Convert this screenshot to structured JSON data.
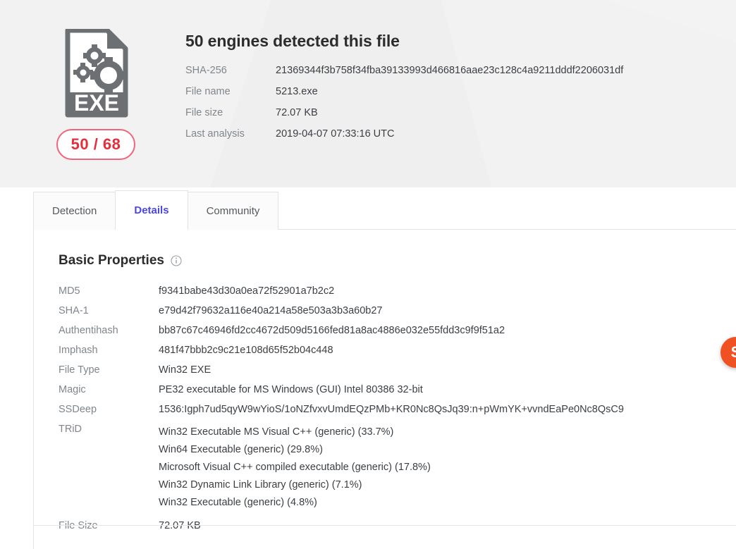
{
  "header": {
    "detection_title": "50 engines detected this file",
    "ratio_badge": "50 / 68",
    "file_icon_label": "EXE",
    "meta": [
      {
        "label": "SHA-256",
        "value": "21369344f3b758f34fba39133993d466816aae23c128c4a9211dddf2206031df"
      },
      {
        "label": "File name",
        "value": "5213.exe"
      },
      {
        "label": "File size",
        "value": "72.07 KB"
      },
      {
        "label": "Last analysis",
        "value": "2019-04-07 07:33:16 UTC"
      }
    ]
  },
  "tabs": [
    {
      "label": "Detection",
      "active": false
    },
    {
      "label": "Details",
      "active": true
    },
    {
      "label": "Community",
      "active": false
    }
  ],
  "details": {
    "section_title": "Basic Properties",
    "info_icon": "info-icon",
    "properties": [
      {
        "label": "MD5",
        "value": "f9341babe43d30a0ea72f52901a7b2c2"
      },
      {
        "label": "SHA-1",
        "value": "e79d42f79632a116e40a214a58e503a3b3a60b27"
      },
      {
        "label": "Authentihash",
        "value": "bb87c67c46946fd2cc4672d509d5166fed81a8ac4886e032e55fdd3c9f9f51a2"
      },
      {
        "label": "Imphash",
        "value": "481f47bbb2c9c21e108d65f52b04c448"
      },
      {
        "label": "File Type",
        "value": "Win32 EXE"
      },
      {
        "label": "Magic",
        "value": "PE32 executable for MS Windows (GUI) Intel 80386 32-bit"
      },
      {
        "label": "SSDeep",
        "value": "1536:Igph7ud5qyW9wYioS/1oNZfvxvUmdEQzPMb+KR0Nc8QsJq39:n+pWmYK+vvndEaPe0Nc8QsC9"
      }
    ],
    "trid": {
      "label": "TRiD",
      "entries": [
        "Win32 Executable MS Visual C++ (generic) (33.7%)",
        "Win64 Executable (generic) (29.8%)",
        "Microsoft Visual C++ compiled executable (generic) (17.8%)",
        "Win32 Dynamic Link Library (generic) (7.1%)",
        "Win32 Executable (generic) (4.8%)"
      ]
    },
    "file_size": {
      "label": "File Size",
      "value": "72.07 KB"
    }
  },
  "side_widget": {
    "glyph": "S"
  },
  "colors": {
    "accent": "#4b46e5",
    "malicious": "#e52e3c",
    "badge_border": "#f0657a",
    "header_bg": "#f2f2f2",
    "label_text": "#80868c",
    "value_text": "#3b3f43",
    "widget": "#ef5123"
  }
}
